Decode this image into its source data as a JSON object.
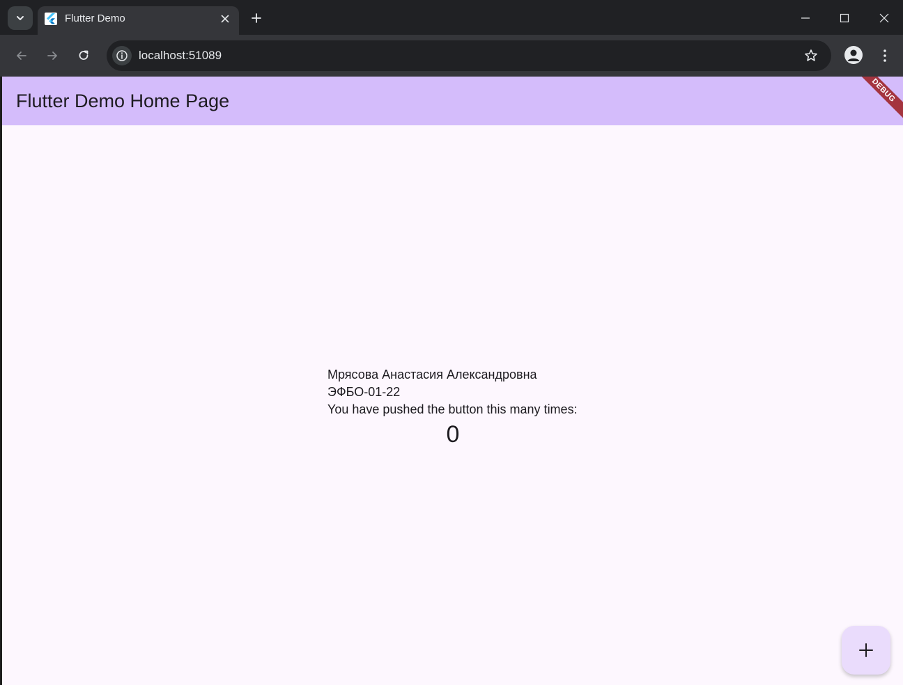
{
  "browser": {
    "tab_title": "Flutter Demo",
    "url": "localhost:51089"
  },
  "app": {
    "title": "Flutter Demo Home Page",
    "debug_banner": "DEBUG",
    "name_line": "Мрясова Анастасия Александровна",
    "group_line": "ЭФБО-01-22",
    "counter_label": "You have pushed the button this many times:",
    "counter_value": "0",
    "fab_icon": "plus-icon"
  },
  "colors": {
    "appbar": "#d4bcfb",
    "background": "#fdf7fe",
    "fab": "#eadcfc",
    "debug": "#a4343f"
  }
}
